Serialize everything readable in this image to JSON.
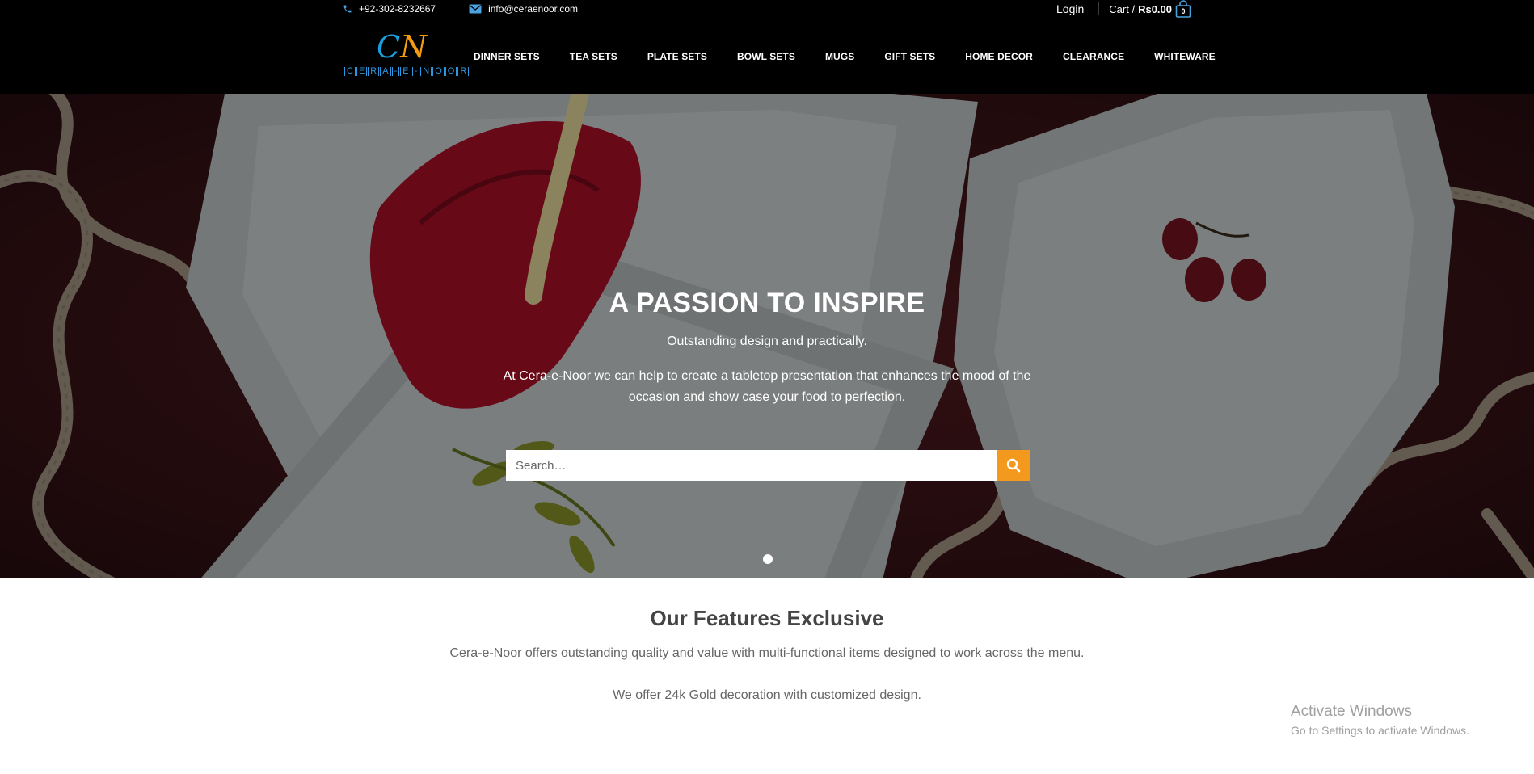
{
  "topbar": {
    "phone": "+92-302-8232667",
    "email": "info@ceraenoor.com",
    "login_label": "Login",
    "cart_label": "Cart /",
    "cart_total": "Rs0.00",
    "cart_count": "0"
  },
  "logo": {
    "mark_c": "C",
    "mark_n": "N",
    "letters": [
      "C",
      "E",
      "R",
      "A",
      "-",
      "E",
      "-",
      "N",
      "O",
      "O",
      "R"
    ]
  },
  "nav": {
    "items": [
      "DINNER SETS",
      "TEA SETS",
      "PLATE SETS",
      "BOWL SETS",
      "MUGS",
      "GIFT SETS",
      "HOME DECOR",
      "CLEARANCE",
      "WHITEWARE"
    ]
  },
  "hero": {
    "title": "A PASSION TO INSPIRE",
    "subtitle": "Outstanding design and practically.",
    "description": "At Cera-e-Noor we can help to create a tabletop presentation that enhances the mood of the occasion and show case your food to perfection.",
    "search_placeholder": "Search…"
  },
  "features": {
    "title": "Our Features Exclusive",
    "p1": "Cera-e-Noor offers outstanding quality and value with multi-functional items designed to work across the menu.",
    "p2": "We offer 24k Gold decoration with customized design."
  },
  "watermark": {
    "title": "Activate Windows",
    "subtitle": "Go to Settings to activate Windows."
  },
  "colors": {
    "header_bg": "#000000",
    "accent_orange": "#f39a1e",
    "brand_blue": "#1aa0e0",
    "anthurium_red": "#b3102a"
  },
  "icons": [
    "phone-icon",
    "mail-icon",
    "cart-bag-icon",
    "search-icon"
  ]
}
